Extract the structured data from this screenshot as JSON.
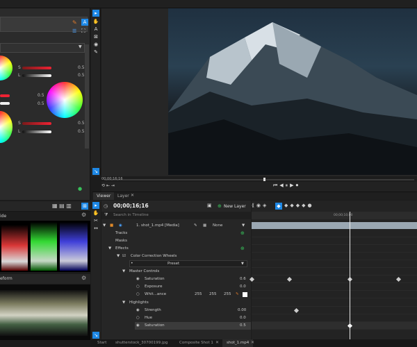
{
  "viewer": {
    "timecode": "00;00;16;16",
    "ruler_label": "00;00;10;00"
  },
  "tabs": [
    {
      "label": "Viewer"
    },
    {
      "label": "Layer"
    }
  ],
  "layer_panel": {
    "timecode": "00;00;16;16",
    "new_layer_label": "New Layer",
    "search_placeholder": "Search in Timeline",
    "layer_name": "1. shot_1.mp4 [Media]",
    "blend_mode": "None",
    "tracks": "Tracks",
    "masks": "Masks",
    "effects": "Effects",
    "effect_name": "Color Correction Wheels",
    "preset": "Preset",
    "master_controls": "Master Controls",
    "saturation": "Saturation",
    "saturation_val": "0.6",
    "exposure": "Exposure",
    "exposure_val": "0.0",
    "white_balance": "Whit...ance",
    "wb_r": "255",
    "wb_g": "255",
    "wb_b": "255",
    "highlights": "Highlights",
    "strength": "Strength",
    "strength_val": "0.00",
    "hue": "Hue",
    "hue_val": "0.0",
    "hl_saturation": "Saturation",
    "hl_saturation_val": "0.5"
  },
  "color_panel": {
    "s_label": "S",
    "l_label": "L",
    "val_05": "0.5",
    "mode_label": "ide",
    "waveform_label": "eform"
  },
  "bottom_tabs": [
    {
      "label": "Start"
    },
    {
      "label": "shutterstock_30700199.jpg"
    },
    {
      "label": "Composite Shot 1"
    },
    {
      "label": "shot_1.mp4"
    }
  ],
  "colors": {
    "accent": "#1e88e5",
    "green": "#38c15a"
  }
}
